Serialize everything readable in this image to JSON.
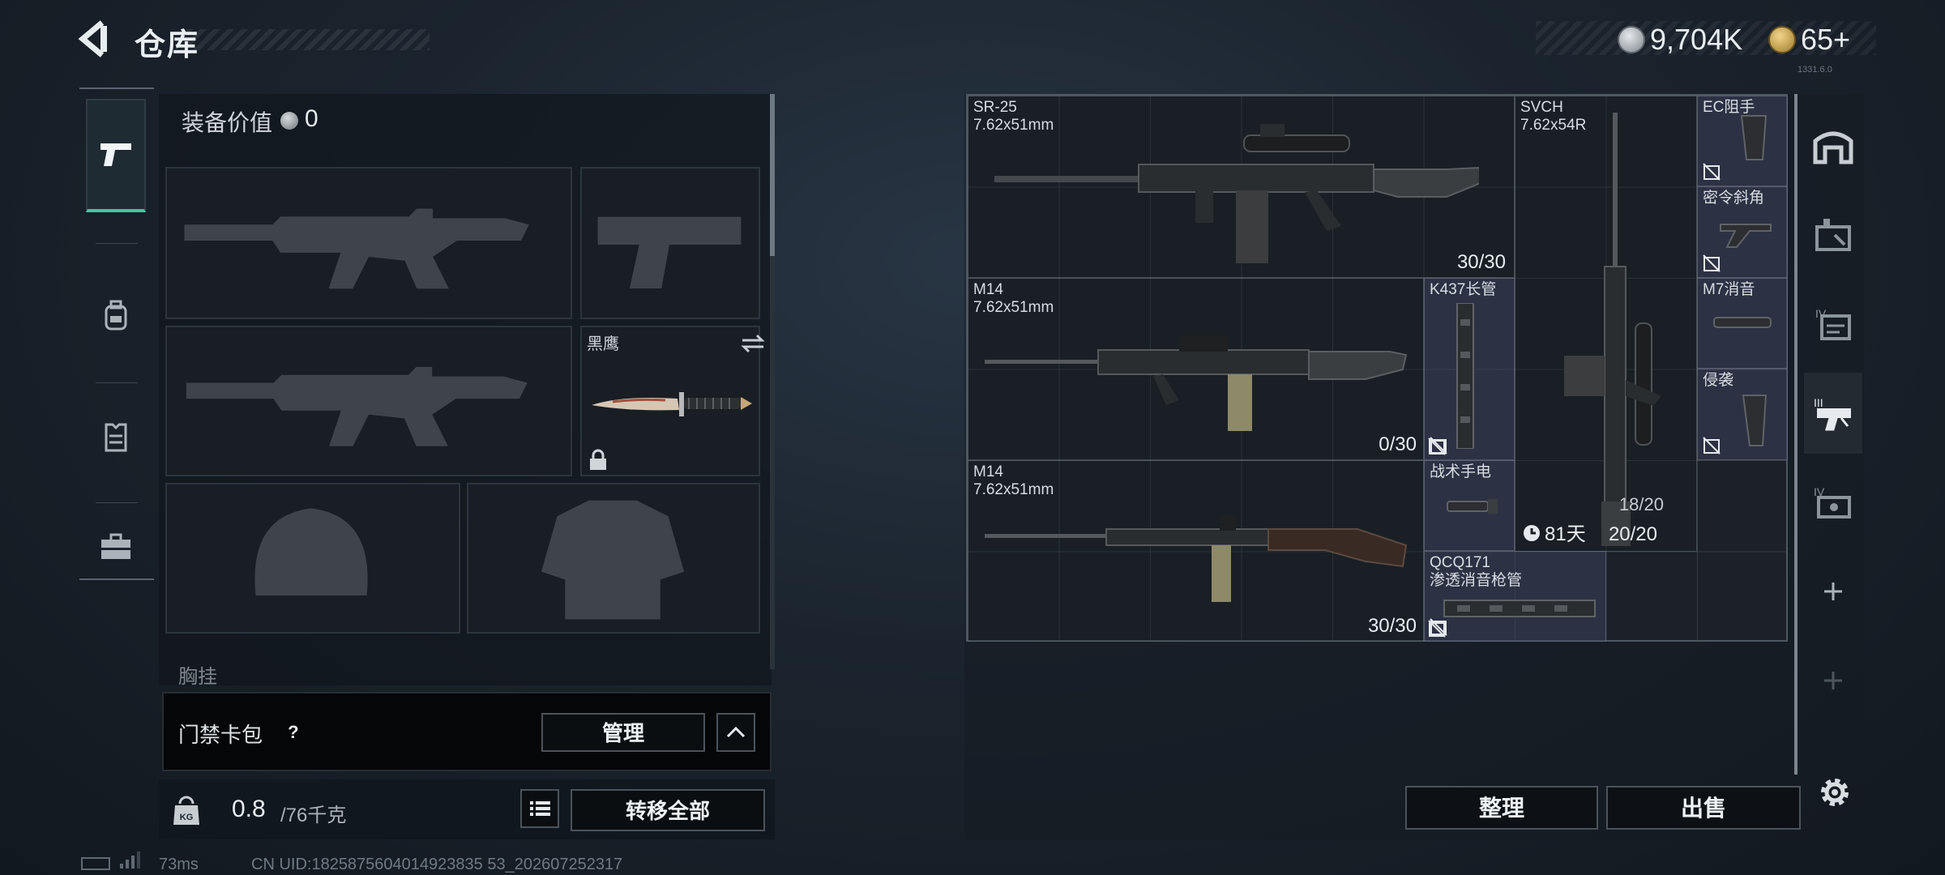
{
  "header": {
    "title": "仓库",
    "currency_coin": "9,704K",
    "currency_gold": "65+",
    "version": "1331.6.0"
  },
  "equipment": {
    "value_label": "装备价值",
    "value": "0",
    "melee_name": "黑鹰",
    "chest_label": "胸挂"
  },
  "keycard": {
    "label": "门禁卡包",
    "help": "?",
    "manage_label": "管理"
  },
  "bottom_bar": {
    "weight_value": "0.8",
    "weight_max": "/76千克",
    "transfer_label": "转移全部"
  },
  "footer": {
    "ping": "73ms",
    "uid": "CN UID:1825875604014923835 53_202607252317"
  },
  "stash": {
    "items": [
      {
        "name": "SR-25",
        "caliber": "7.62x51mm",
        "count": "30/30"
      },
      {
        "name": "SVCH",
        "caliber": "7.62x54R",
        "count_small": "18/20",
        "count": "20/20",
        "days": "81天"
      },
      {
        "name": "EC阻手"
      },
      {
        "name": "密令斜角"
      },
      {
        "name": "M14",
        "caliber": "7.62x51mm",
        "count": "0/30"
      },
      {
        "name": "K437长管"
      },
      {
        "name": "M7消音"
      },
      {
        "name": "侵袭"
      },
      {
        "name": "M14",
        "caliber": "7.62x51mm",
        "count": "30/30"
      },
      {
        "name": "战术手电"
      },
      {
        "name": "QCQ171",
        "caliber": "渗透消音枪管"
      }
    ]
  },
  "actions": {
    "organize_label": "整理",
    "sell_label": "出售"
  },
  "side_tabs": [
    "stash-main",
    "stash-tab-1",
    "stash-tab-2",
    "stash-tab-3",
    "stash-tab-4",
    "add-tab",
    "add-tab-disabled"
  ],
  "colors": {
    "accent": "#3fc7a0",
    "attachment_bg": "#3c405c",
    "panel_bg": "#10161c"
  }
}
